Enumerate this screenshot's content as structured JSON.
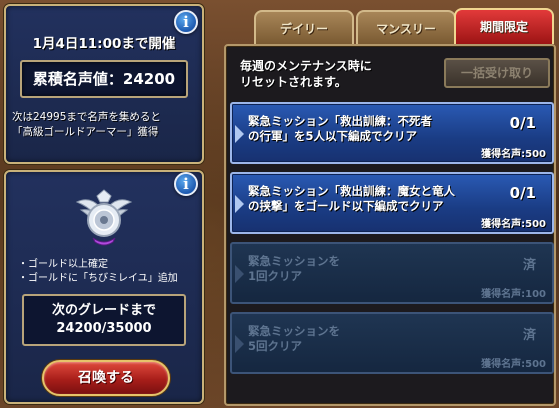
{
  "event": {
    "period": "1月4日11:00まで開催",
    "total_fame_label": "累積名声値：24200",
    "reward_note_line1": "次は24995まで名声を集めると",
    "reward_note_line2": "「高級ゴールドアーマー」獲得"
  },
  "grade": {
    "perks": [
      "ゴールド以上確定",
      "ゴールドに「ちびミレイユ」追加"
    ],
    "next_label": "次のグレードまで",
    "progress_text": "24200/35000",
    "progress_fraction": 0.6914,
    "summon_label": "召喚する"
  },
  "tabs": [
    {
      "label": "デイリー",
      "active": false
    },
    {
      "label": "マンスリー",
      "active": false
    },
    {
      "label": "期間限定",
      "active": true
    }
  ],
  "missions_panel": {
    "reset_note_line1": "毎週のメンテナンス時に",
    "reset_note_line2": "リセットされます。",
    "claim_all_label": "一括受け取り"
  },
  "missions": [
    {
      "title_line1": "緊急ミッション「救出訓練：不死者",
      "title_line2": "の行軍」を5人以下編成でクリア",
      "progress": "0/1",
      "reward": "獲得名声:500",
      "state": "active"
    },
    {
      "title_line1": "緊急ミッション「救出訓練：魔女と竜人",
      "title_line2": "の挟撃」をゴールド以下編成でクリア",
      "progress": "0/1",
      "reward": "獲得名声:500",
      "state": "active"
    },
    {
      "title_line1": "緊急ミッションを",
      "title_line2": "1回クリア",
      "progress": "済",
      "reward": "獲得名声:100",
      "state": "completed"
    },
    {
      "title_line1": "緊急ミッションを",
      "title_line2": "5回クリア",
      "progress": "済",
      "reward": "獲得名声:500",
      "state": "completed"
    }
  ],
  "colors": {
    "panel_navy": "#22315e",
    "mission_blue": "#2a5ab4",
    "tab_active_red": "#e23a3a",
    "gold_border": "#c9b27a"
  },
  "icons": [
    "info-icon",
    "emblem-icon",
    "arrow-icon"
  ]
}
